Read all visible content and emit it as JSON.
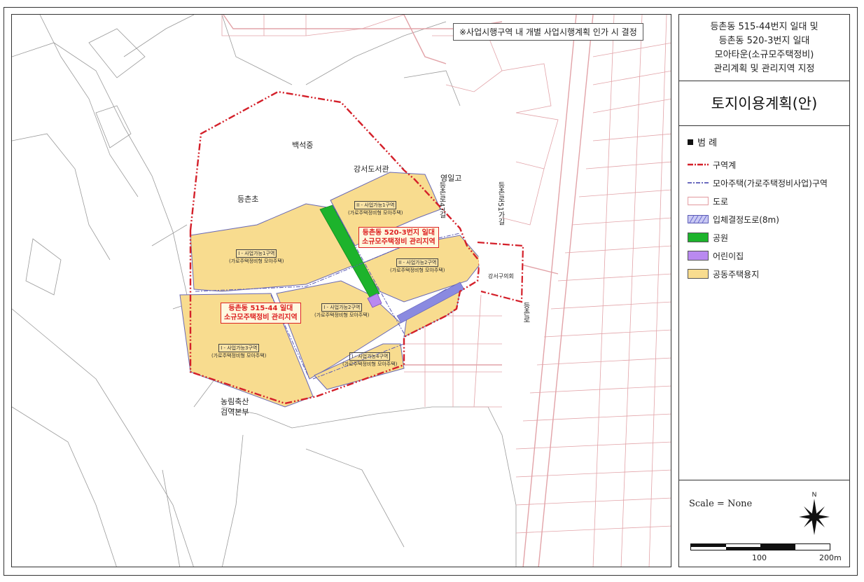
{
  "notice": "※사업시행구역 내 개별 사업시행계획 인가 시 결정",
  "title_lines": [
    "등촌동 515-44번지 일대 및",
    "등촌동 520-3번지 일대",
    "모아타운(소규모주택정비)",
    "관리계획 및 관리지역 지정"
  ],
  "subtitle": "토지이용계획(안)",
  "legend": {
    "title": "범  례",
    "items": [
      {
        "label": "구역계",
        "swatch": "boundary",
        "color": "#d4202a"
      },
      {
        "label": "모아주택(가로주택정비사업)구역",
        "swatch": "moa",
        "color": "#3a3aa8"
      },
      {
        "label": "도로",
        "swatch": "road",
        "color": "#e6a5aa"
      },
      {
        "label": "입체결정도로(8m)",
        "swatch": "road3d",
        "color": "#8a8ae0"
      },
      {
        "label": "공원",
        "swatch": "park",
        "color": "#1db32c"
      },
      {
        "label": "어린이집",
        "swatch": "daycare",
        "color": "#b989f0"
      },
      {
        "label": "공동주택용지",
        "swatch": "housing",
        "color": "#f8dc8f"
      }
    ]
  },
  "scale": {
    "text": "Scale = None",
    "north": "N",
    "marks": [
      "100",
      "200m"
    ]
  },
  "places": {
    "baekseok": "백석중",
    "library": "강서도서관",
    "yeongil": "영일고",
    "deungchon_elem": "등촌초",
    "council": "강서구의회",
    "quarantine_1": "농림축산",
    "quarantine_2": "검역본부",
    "road_47": "등촌로47길",
    "road_51": "등촌로51가길",
    "road_main": "등촌로"
  },
  "zones": [
    {
      "tag": "I - 사업가능1구역",
      "type": "(가로주택정비형 모아주택)"
    },
    {
      "tag": "I - 사업가능2구역",
      "type": "(가로주택정비형 모아주택)"
    },
    {
      "tag": "I - 사업가능3구역",
      "type": "(가로주택정비형 모아주택)"
    },
    {
      "tag": "I - 사업가능4구역",
      "type": "(가로주택정비형 모아주택)"
    },
    {
      "tag": "II - 사업가능1구역",
      "type": "(가로주택정비형 모아주택)"
    },
    {
      "tag": "II - 사업가능2구역",
      "type": "(가로주택정비형 모아주택)"
    }
  ],
  "management_areas": [
    {
      "line1": "등촌동 520-3번지 일대",
      "line2": "소규모주택정비 관리지역"
    },
    {
      "line1": "등촌동 515-44 일대",
      "line2": "소규모주택정비 관리지역"
    }
  ]
}
